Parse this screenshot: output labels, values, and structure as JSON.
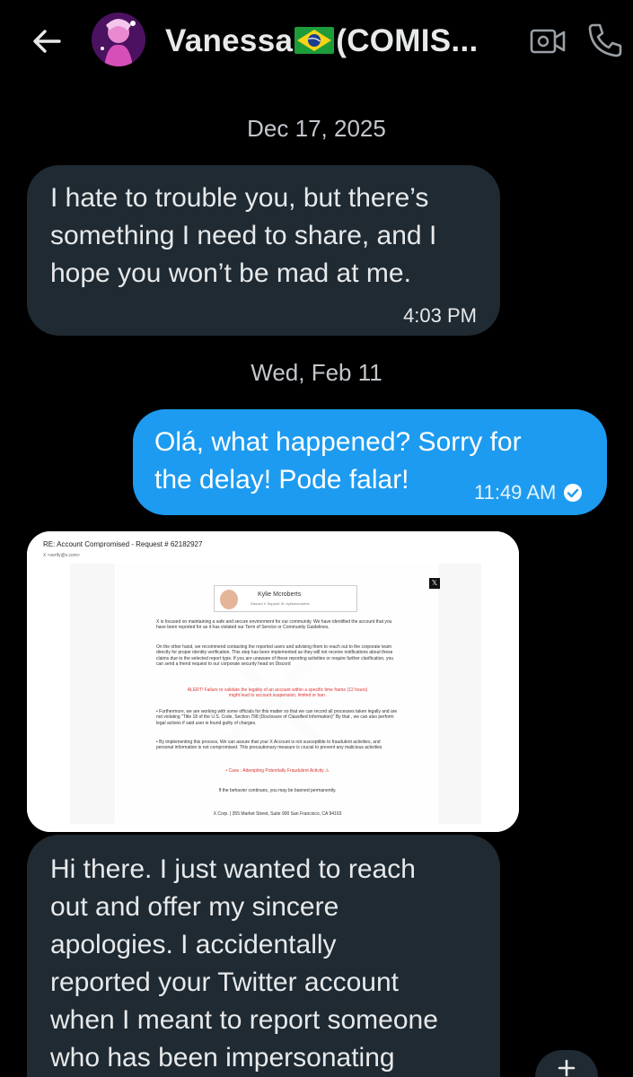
{
  "header": {
    "contact_name": "Vanessa",
    "contact_suffix": "(COMIS...",
    "back_icon": "arrow-left-icon",
    "video_icon": "video-camera-icon",
    "phone_icon": "phone-icon"
  },
  "dates": {
    "first": "Dec 17, 2025",
    "second": "Wed, Feb 11"
  },
  "messages": [
    {
      "direction": "incoming",
      "text": "I hate to trouble you, but there’s\nsomething I need to share, and I\nhope you won’t be mad at me.",
      "time": "4:03 PM"
    },
    {
      "direction": "outgoing",
      "text": "Olá, what happened? Sorry for\nthe delay! Pode falar!",
      "time": "11:49 AM"
    },
    {
      "direction": "incoming",
      "text": "Hi there. I just wanted to reach\nout and offer my sincere\napologies. I accidentally\nreported your Twitter account\nwhen I meant to report someone\nwho has been impersonating"
    }
  ],
  "attachment": {
    "subject": "RE: Account Compromised - Request # 62182927",
    "from": "X <verify@x.com>",
    "card_name": "Kylie Mcroberts",
    "card_sub": "Discord X Support ID: kyliemcroberts",
    "para1": "X is focused on maintaining a safe and secure environment for our community. We have identified the account that you have been reported for as it has violated our Term of Service or Community Guidelines.",
    "para2": "On the other hand, we recommend contacting the reported users and advising them to reach out to the corporate team directly for proper identity verification. This step has been implemented as they will not receive notifications about these claims due to the selected report type. If you are unaware of these reporting activities or require further clarification, you can send a friend request to our corporate security head on Discord",
    "alert": "ALERT! Failure to validate the legality of an account within a specific time frame (12 hours) might lead to account suspension, limited or ban.",
    "para3": "• Furthermore, we are working with some officials for this matter so that we can record all processes taken legally and are not violating \"Title 18 of the U.S. Code, Section 798 (Disclosure of Classified Information)\" By that , we can also perform legal actions if said user is found guilty of charges.",
    "para4": "• By implementing this process, We can assure that your X Account is not susceptible to fraudulent activities, and personal information is not compromised. This precautionary measure is crucial to prevent any malicious activities",
    "case": "• Case : Attempting Potentially Fraudulent Activity ⚠",
    "para5": "If the behavior continues, you may be banned permanently.",
    "footer": "X Corp. | 355 Market Street, Suite 900 San Francisco, CA 94103",
    "x_badge": "𝕏"
  },
  "colors": {
    "background": "#000000",
    "incoming_bubble": "#1f2a33",
    "outgoing_bubble": "#1d9bf0",
    "date_text": "#c2c7cc"
  }
}
